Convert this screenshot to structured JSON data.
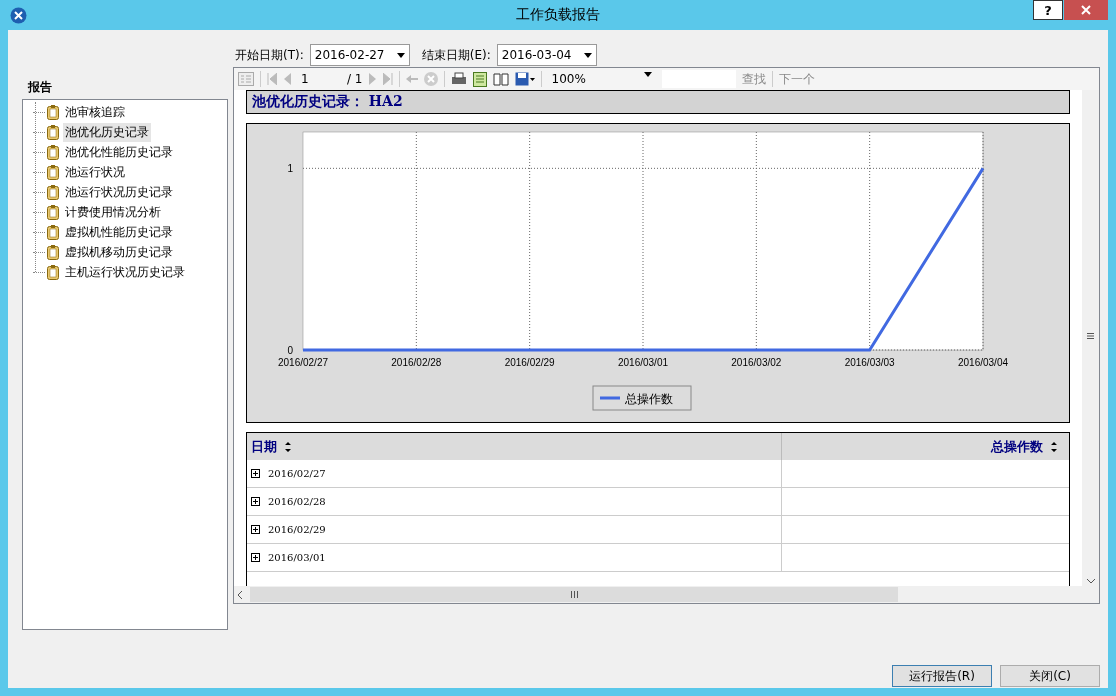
{
  "window": {
    "title": "工作负载报告",
    "help_button": "?"
  },
  "date_range": {
    "start_label": "开始日期(T):",
    "start_value": "2016-02-27",
    "end_label": "结束日期(E):",
    "end_value": "2016-03-04"
  },
  "sidebar": {
    "title": "报告",
    "items": [
      {
        "label": "池审核追踪",
        "selected": false
      },
      {
        "label": "池优化历史记录",
        "selected": true
      },
      {
        "label": "池优化性能历史记录",
        "selected": false
      },
      {
        "label": "池运行状况",
        "selected": false
      },
      {
        "label": "池运行状况历史记录",
        "selected": false
      },
      {
        "label": "计费使用情况分析",
        "selected": false
      },
      {
        "label": "虚拟机性能历史记录",
        "selected": false
      },
      {
        "label": "虚拟机移动历史记录",
        "selected": false
      },
      {
        "label": "主机运行状况历史记录",
        "selected": false
      }
    ]
  },
  "toolbar": {
    "page": "1",
    "page_total": "/ 1",
    "zoom": "100%",
    "find": "查找",
    "next": "下一个"
  },
  "report": {
    "title": "池优化历史记录： HA2",
    "chart_data": {
      "type": "line",
      "categories": [
        "2016/02/27",
        "2016/02/28",
        "2016/02/29",
        "2016/03/01",
        "2016/03/02",
        "2016/03/03",
        "2016/03/04"
      ],
      "series": [
        {
          "name": "总操作数",
          "color": "#4169e1",
          "values": [
            0,
            0,
            0,
            0,
            0,
            0,
            1
          ]
        }
      ],
      "ylim": [
        0,
        1.2
      ],
      "yticks": [
        0,
        1
      ],
      "grid": true
    },
    "table": {
      "columns": [
        "日期",
        "总操作数"
      ],
      "rows": [
        {
          "date": "2016/02/27"
        },
        {
          "date": "2016/02/28"
        },
        {
          "date": "2016/02/29"
        },
        {
          "date": "2016/03/01"
        }
      ]
    }
  },
  "buttons": [
    "运行报告(R)",
    "关闭(C)"
  ]
}
